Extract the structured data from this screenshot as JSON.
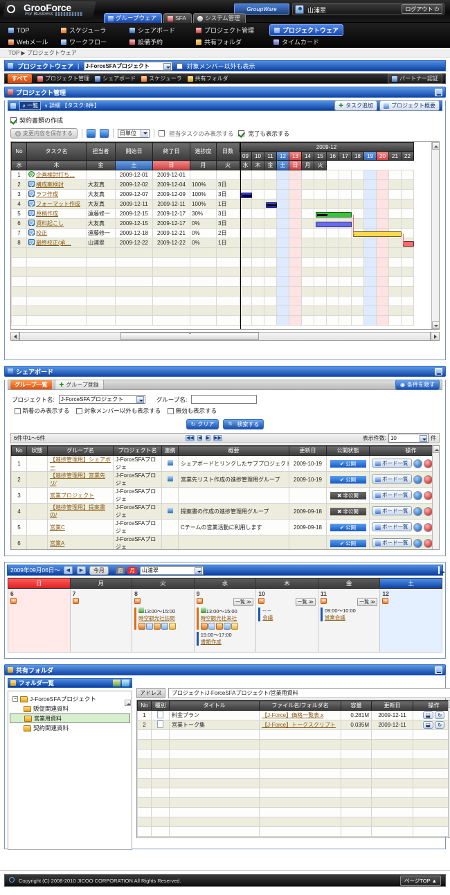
{
  "app": {
    "brand": "GrooForce",
    "brand_sub": "For Business",
    "groupware_badge": "GroupWare",
    "user_name": "山浦翠",
    "logout": "ログアウト"
  },
  "primary_tabs": [
    {
      "label": "グループウェア",
      "active": true,
      "icon": "groupware-icon"
    },
    {
      "label": "SFA",
      "active": false,
      "icon": "sfa-icon"
    },
    {
      "label": "システム管理",
      "active": false,
      "icon": "gear-icon"
    }
  ],
  "menu": {
    "row1": [
      {
        "label": "TOP",
        "icon": "home-icon",
        "active": false
      },
      {
        "label": "スケジューラ",
        "icon": "calendar-icon",
        "active": false
      },
      {
        "label": "シェアボード",
        "icon": "board-icon",
        "active": false
      },
      {
        "label": "プロジェクト管理",
        "icon": "project-icon",
        "active": false
      },
      {
        "label": "プロジェクトウェア",
        "icon": "projectware-icon",
        "active": true
      }
    ],
    "row2": [
      {
        "label": "Webメール",
        "icon": "mail-icon",
        "active": false
      },
      {
        "label": "ワークフロー",
        "icon": "workflow-icon",
        "active": false
      },
      {
        "label": "設備予約",
        "icon": "facility-icon",
        "active": false
      },
      {
        "label": "共有フォルダ",
        "icon": "folder-icon",
        "active": false
      },
      {
        "label": "タイムカード",
        "icon": "timecard-icon",
        "active": false
      }
    ]
  },
  "breadcrumb": "TOP ▶ プロジェクトウェア",
  "selector": {
    "title": "プロジェクトウェア",
    "project": "J-ForceSFAプロジェクト",
    "show_nonmember_label": "対象メンバー以外も表示"
  },
  "substrip": {
    "all": "すべて",
    "items": [
      {
        "label": "プロジェクト管理",
        "icon": "project-icon"
      },
      {
        "label": "シェアボード",
        "icon": "board-icon"
      },
      {
        "label": "スケジューラ",
        "icon": "calendar-icon"
      },
      {
        "label": "共有フォルダ",
        "icon": "folder-icon"
      }
    ],
    "partner": "パートナー認証"
  },
  "project_panel": {
    "title": "プロジェクト管理",
    "tab_list": "一覧",
    "tab_detail": "詳細",
    "task_count": "【タスク:8件】",
    "add_task": "タスク追加",
    "overview": "プロジェクト概要",
    "project_check_label": "契約書類の作成",
    "save_changes": "変更内容を保存する",
    "unit": "日単位",
    "only_my_tasks": "担当タスクのみ表示する",
    "show_completed": "完了も表示する"
  },
  "chart_data": {
    "type": "bar",
    "title": "2009-12",
    "xlabel": "",
    "ylabel": "",
    "columns": [
      "No",
      "タスク名",
      "担当者",
      "開始日",
      "終了日",
      "進捗度",
      "日数"
    ],
    "month_header": "2009-12",
    "days": [
      {
        "d": "09",
        "w": "水",
        "kind": "weekday"
      },
      {
        "d": "10",
        "w": "木",
        "kind": "weekday"
      },
      {
        "d": "11",
        "w": "金",
        "kind": "weekday"
      },
      {
        "d": "12",
        "w": "土",
        "kind": "sat"
      },
      {
        "d": "13",
        "w": "日",
        "kind": "sun"
      },
      {
        "d": "14",
        "w": "月",
        "kind": "weekday"
      },
      {
        "d": "15",
        "w": "火",
        "kind": "weekday"
      },
      {
        "d": "16",
        "w": "水",
        "kind": "weekday"
      },
      {
        "d": "17",
        "w": "木",
        "kind": "weekday"
      },
      {
        "d": "18",
        "w": "金",
        "kind": "weekday"
      },
      {
        "d": "19",
        "w": "土",
        "kind": "sat"
      },
      {
        "d": "20",
        "w": "日",
        "kind": "sun"
      },
      {
        "d": "21",
        "w": "月",
        "kind": "weekday"
      },
      {
        "d": "22",
        "w": "火",
        "kind": "weekday"
      }
    ],
    "tasks": [
      {
        "no": "1",
        "name": "企画検討打ち…",
        "owner": "",
        "start": "2009-12-01",
        "end": "2009-12-01",
        "progress": "",
        "days": "",
        "state": "milestone",
        "bar": null
      },
      {
        "no": "2",
        "name": "構成案検討",
        "owner": "大友真",
        "start": "2009-12-02",
        "end": "2009-12-04",
        "progress": "100%",
        "days": "3日",
        "state": "done",
        "bar": null
      },
      {
        "no": "3",
        "name": "ラフ作成",
        "owner": "大友真",
        "start": "2009-12-07",
        "end": "2009-12-09",
        "progress": "100%",
        "days": "3日",
        "state": "done",
        "bar": {
          "start_day": "09",
          "span": 1,
          "color": "#3a3af0",
          "progress_pct": 100
        }
      },
      {
        "no": "4",
        "name": "フォーマット作成",
        "owner": "大友真",
        "start": "2009-12-11",
        "end": "2009-12-11",
        "progress": "100%",
        "days": "1日",
        "state": "done",
        "bar": {
          "start_day": "11",
          "span": 1,
          "color": "#3a3af0",
          "progress_pct": 100
        }
      },
      {
        "no": "5",
        "name": "原稿作成",
        "owner": "遠藤修一",
        "start": "2009-12-15",
        "end": "2009-12-17",
        "progress": "30%",
        "days": "3日",
        "state": "done",
        "bar": {
          "start_day": "15",
          "span": 3,
          "color": "#3cc23c",
          "progress_pct": 30
        }
      },
      {
        "no": "6",
        "name": "資料起こし",
        "owner": "大友真",
        "start": "2009-12-15",
        "end": "2009-12-17",
        "progress": "0%",
        "days": "3日",
        "state": "done",
        "bar": {
          "start_day": "15",
          "span": 3,
          "color": "#6a6aee",
          "progress_pct": 0
        }
      },
      {
        "no": "7",
        "name": "校正",
        "owner": "遠藤修一",
        "start": "2009-12-18",
        "end": "2009-12-21",
        "progress": "0%",
        "days": "2日",
        "state": "done",
        "bar": {
          "start_day": "18",
          "span": 4,
          "color": "#fbd84a",
          "progress_pct": 0
        }
      },
      {
        "no": "8",
        "name": "最終校正(承…",
        "owner": "山浦翠",
        "start": "2009-12-22",
        "end": "2009-12-22",
        "progress": "0%",
        "days": "1日",
        "state": "done",
        "bar": {
          "start_day": "22",
          "span": 1,
          "color": "#f96a6a",
          "progress_pct": 0
        }
      }
    ]
  },
  "shareboard": {
    "title": "シェアボード",
    "tab_list": "グループ一覧",
    "tab_register": "グループ登録",
    "collapse_cond": "条件を隠す",
    "project_label": "プロジェクト名:",
    "project_value": "J-ForceSFAプロジェクト",
    "group_label": "グループ名:",
    "group_value": "",
    "chk_new_only": "新着のみ表示する",
    "chk_nonmember": "対象メンバー以外も表示する",
    "chk_invalid": "無効も表示する",
    "btn_clear": "クリア",
    "btn_search": "検索する",
    "page_info": "6件中1～6件",
    "rows_label": "表示件数:",
    "rows_value": "10",
    "rows_unit": "件",
    "columns": [
      "No",
      "状態",
      "グループ名",
      "プロジェクト名",
      "連携",
      "概要",
      "更新日",
      "公開状態",
      "操作"
    ],
    "rows": [
      {
        "no": "1",
        "state": "",
        "group": "【進捗管理用】シェアボー",
        "project": "J-ForceSFAプロジェ",
        "link": true,
        "summary": "シェアボードとリンクしたサブプロジェクトの進捗管理用",
        "updated": "2009-10-19",
        "status": "公開",
        "status_kind": "public",
        "op": "ボード一覧"
      },
      {
        "no": "2",
        "state": "",
        "group": "【進捗管理用】営業先リ⁄",
        "project": "J-ForceSFAプロジェ",
        "link": true,
        "summary": "営業先リスト作成の進捗管理用グループ",
        "updated": "2009-10-19",
        "status": "公開",
        "status_kind": "public",
        "op": "ボード一覧"
      },
      {
        "no": "3",
        "state": "",
        "group": "営業プロジェクト",
        "project": "J-ForceSFAプロジェ",
        "link": false,
        "summary": "",
        "updated": "",
        "status": "非公開",
        "status_kind": "private",
        "op": "ボード一覧"
      },
      {
        "no": "4",
        "state": "",
        "group": "【進捗管理用】提案書の/",
        "project": "J-ForceSFAプロジェ",
        "link": true,
        "summary": "提案書の作成の進捗管理用グループ",
        "updated": "2009-09-18",
        "status": "非公開",
        "status_kind": "private",
        "op": "ボード一覧"
      },
      {
        "no": "5",
        "state": "",
        "group": "営業C",
        "project": "J-ForceSFAプロジェ",
        "link": false,
        "summary": "Cチームの営業活動に利用します",
        "updated": "2009-09-18",
        "status": "公開",
        "status_kind": "public",
        "op": "ボード一覧"
      },
      {
        "no": "6",
        "state": "",
        "group": "営業A",
        "project": "J-ForceSFAプロジェ",
        "link": false,
        "summary": "",
        "updated": "",
        "status": "公開",
        "status_kind": "public",
        "op": "ボード一覧"
      }
    ]
  },
  "schedule": {
    "range": "2009年09月06日～",
    "this_month": "今月",
    "week_btn": "週",
    "month_btn": "月",
    "user": "山浦翠",
    "weekdays": [
      "日",
      "月",
      "火",
      "水",
      "木",
      "金",
      "土"
    ],
    "list_btn": "一覧",
    "days": [
      {
        "num": "6",
        "kind": "sunday",
        "has_add": true,
        "has_list": false,
        "events": []
      },
      {
        "num": "7",
        "kind": "weekday",
        "has_add": true,
        "has_list": false,
        "events": []
      },
      {
        "num": "8",
        "kind": "weekday",
        "has_add": true,
        "has_list": false,
        "events": [
          {
            "time": "13:00～15:00",
            "title": "時空観光社訪問",
            "color": "orange",
            "icons": true
          }
        ]
      },
      {
        "num": "9",
        "kind": "weekday",
        "has_add": true,
        "has_list": true,
        "events": [
          {
            "time": "13:00～15:00",
            "title": "時空観光社来社",
            "color": "orange",
            "icons": true
          },
          {
            "time": "15:00～17:00",
            "title": "書類作成",
            "color": "blue",
            "icons": false
          }
        ]
      },
      {
        "num": "10",
        "kind": "weekday",
        "has_add": true,
        "has_list": true,
        "events": [
          {
            "time": "--:--",
            "title": "会議",
            "color": "blue",
            "icons": false
          }
        ]
      },
      {
        "num": "11",
        "kind": "weekday",
        "has_add": true,
        "has_list": true,
        "events": [
          {
            "time": "09:00～10:00",
            "title": "営業会議",
            "color": "blue",
            "icons": false
          }
        ]
      },
      {
        "num": "12",
        "kind": "saturday",
        "has_add": true,
        "has_list": false,
        "events": []
      }
    ]
  },
  "folder": {
    "title": "共有フォルダ",
    "tree_title": "フォルダ一覧",
    "root": "J-ForceSFAプロジェクト",
    "children": [
      {
        "label": "販促関連資料",
        "selected": false
      },
      {
        "label": "営業用資料",
        "selected": true
      },
      {
        "label": "契約関連資料",
        "selected": false
      }
    ],
    "addr_label": "アドレス",
    "addr_value": "プロジェクト/J-ForceSFAプロジェクト/営業用資料",
    "columns": [
      "No",
      "種別",
      "タイトル",
      "ファイル名/フォルダ名",
      "容量",
      "更新日",
      "操作"
    ],
    "rows": [
      {
        "no": "1",
        "type": "file",
        "title": "料金プラン",
        "filename": "【J-Force】価格一覧表.x",
        "size": "0.281M",
        "updated": "2009-12-11"
      },
      {
        "no": "2",
        "type": "file",
        "title": "営業トーク集",
        "filename": "【J-Force】トークスクリプト",
        "size": "0.035M",
        "updated": "2009-12-11"
      }
    ]
  },
  "footer": {
    "copyright": "Copyright (C) 2008-2010 JICOO CORPORATION All Rights Reserved.",
    "page_top": "ページTOP"
  }
}
